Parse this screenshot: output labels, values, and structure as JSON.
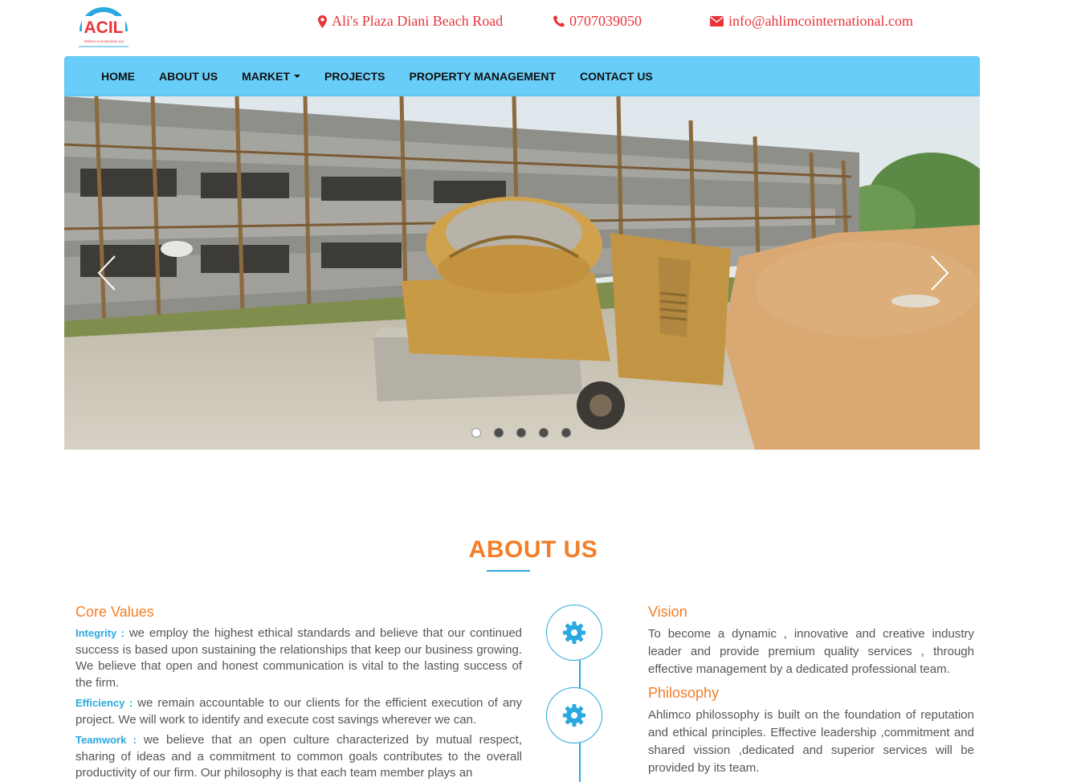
{
  "header": {
    "logo_text": "ACIL",
    "logo_subtext": "Ahlimco Construction Ltd",
    "address": "Ali's Plaza Diani Beach Road",
    "phone": "0707039050",
    "email": "info@ahlimcointernational.com"
  },
  "nav": {
    "items": [
      {
        "label": "HOME"
      },
      {
        "label": "ABOUT US"
      },
      {
        "label": "MARKET"
      },
      {
        "label": "PROJECTS"
      },
      {
        "label": "PROPERTY MANAGEMENT"
      },
      {
        "label": "CONTACT US"
      }
    ]
  },
  "carousel": {
    "slide_count": 5,
    "active_index": 0
  },
  "about": {
    "title": "ABOUT US",
    "core_values": {
      "heading": "Core Values",
      "items": [
        {
          "label": "Integrity :",
          "text": " we employ the highest ethical standards and believe that our continued success is based upon sustaining the relationships that keep our business growing. We believe that open and honest communication is vital to the lasting success of the firm."
        },
        {
          "label": "Efficiency :",
          "text": " we remain accountable to our clients for the efficient execution of any project. We will work to identify and execute cost savings wherever we can."
        },
        {
          "label": "Teamwork :",
          "text": " we believe that an open culture characterized by mutual respect, sharing of ideas and a commitment to common goals contributes to the overall productivity of our firm. Our philosophy is that each team member plays an"
        }
      ]
    },
    "vision": {
      "heading": "Vision",
      "text": "To become a dynamic , innovative and creative industry leader and provide premium quality services , through effective management by a dedicated professional team."
    },
    "philosophy": {
      "heading": "Philosophy",
      "text": "Ahlimco philossophy is built on the foundation of reputation and ethical principles. Effective leadership ,commitment and shared vission ,dedicated and superior services will be provided by its team."
    }
  },
  "colors": {
    "accent_orange": "#f37e27",
    "accent_blue": "#29a9e0",
    "nav_bg": "#68cdf8",
    "contact_red": "#e8343a"
  }
}
